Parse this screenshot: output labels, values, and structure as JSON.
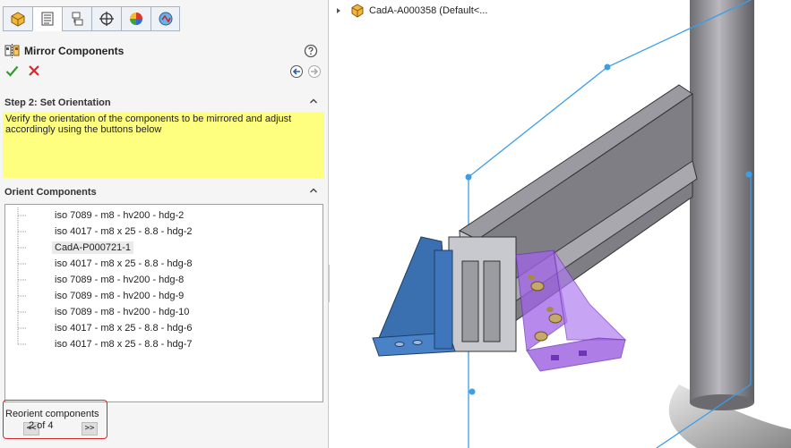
{
  "panel": {
    "tabs": [
      {
        "icon": "feature-manager-icon"
      },
      {
        "icon": "property-manager-icon"
      },
      {
        "icon": "configuration-manager-icon"
      },
      {
        "icon": "dimxpert-icon"
      },
      {
        "icon": "display-manager-icon"
      },
      {
        "icon": "cam-manager-icon"
      }
    ],
    "title": "Mirror Components",
    "step_header": "Step 2: Set Orientation",
    "message": "Verify the orientation of the components to be mirrored and adjust accordingly using the buttons below",
    "orient_header": "Orient Components",
    "components": [
      "iso 7089 - m8 - hv200 - hdg-2",
      "iso 4017 - m8 x 25 - 8.8 - hdg-2",
      "CadA-P000721-1",
      "iso 4017 - m8 x 25 - 8.8 - hdg-8",
      "iso 7089 - m8 - hv200 - hdg-8",
      "iso 7089 - m8 - hv200 - hdg-9",
      "iso 7089 - m8 - hv200 - hdg-10",
      "iso 4017 - m8 x 25 - 8.8 - hdg-6",
      "iso 4017 - m8 x 25 - 8.8 - hdg-7"
    ],
    "selected_component": "CadA-P000721-1",
    "reorient_label": "Reorient components",
    "prev_label": "<<",
    "next_label": ">>",
    "counter": "2 of 4"
  },
  "graphics": {
    "tree_label": "CadA-A000358  (Default<..."
  },
  "colors": {
    "ok_green": "#2e9e2e",
    "cancel_red": "#d9262c",
    "message_bg": "#ffff7f",
    "highlight_border": "#d9262c",
    "plane_blue": "#3b9ee8",
    "purple_selection": "#a162e8"
  }
}
